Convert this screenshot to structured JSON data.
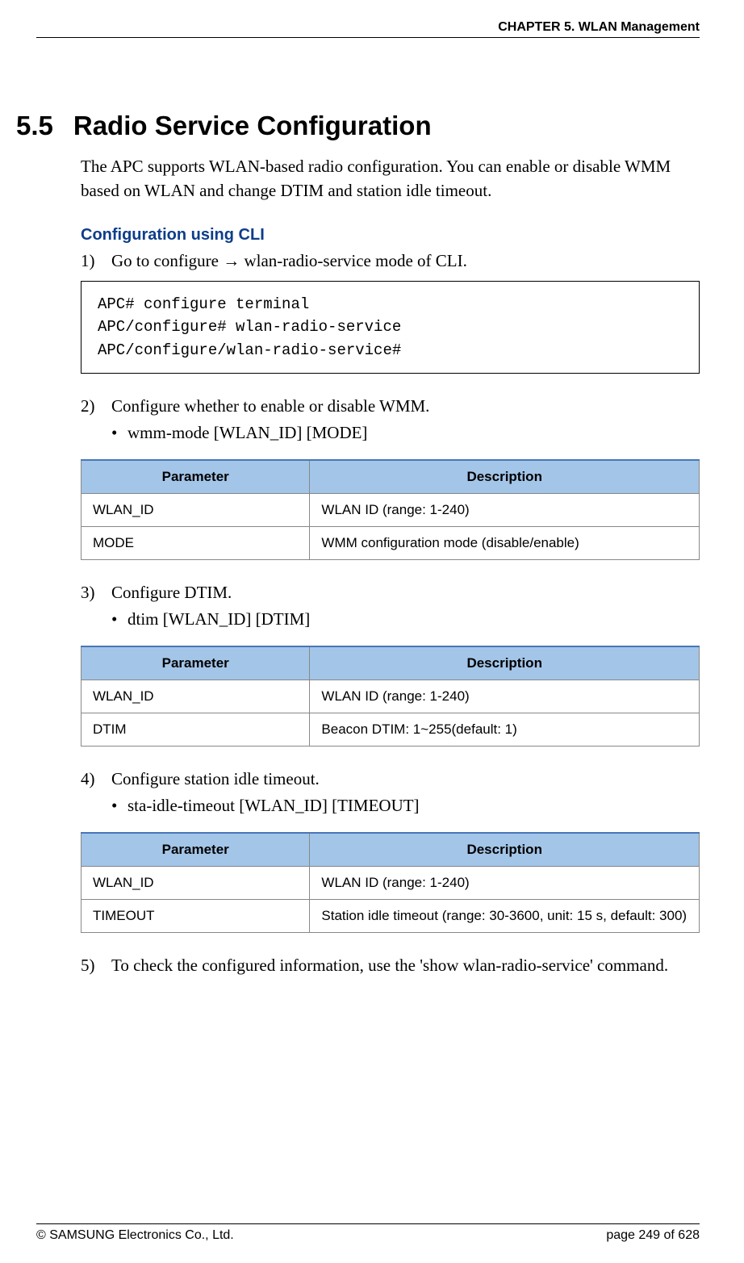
{
  "header": {
    "chapter": "CHAPTER 5. WLAN Management"
  },
  "section": {
    "number": "5.5",
    "title": "Radio Service Configuration",
    "intro": "The APC supports WLAN-based radio configuration. You can enable or disable WMM based on WLAN and change DTIM and station idle timeout."
  },
  "subsection": {
    "title": "Configuration using CLI"
  },
  "steps": {
    "s1_num": "1)",
    "s1_text": "Go to configure → wlan-radio-service mode of CLI.",
    "s2_num": "2)",
    "s2_text": "Configure whether to enable or disable WMM.",
    "s2_bullet": "wmm-mode [WLAN_ID] [MODE]",
    "s3_num": "3)",
    "s3_text": "Configure DTIM.",
    "s3_bullet": "dtim [WLAN_ID] [DTIM]",
    "s4_num": "4)",
    "s4_text": "Configure station idle timeout.",
    "s4_bullet": "sta-idle-timeout [WLAN_ID] [TIMEOUT]",
    "s5_num": "5)",
    "s5_text": "To check the configured information, use the 'show wlan-radio-service' command."
  },
  "code": "APC# configure terminal\nAPC/configure# wlan-radio-service\nAPC/configure/wlan-radio-service#",
  "table_headers": {
    "param": "Parameter",
    "desc": "Description"
  },
  "table1": {
    "r1c1": "WLAN_ID",
    "r1c2": "WLAN ID (range: 1-240)",
    "r2c1": "MODE",
    "r2c2": "WMM configuration mode (disable/enable)"
  },
  "table2": {
    "r1c1": "WLAN_ID",
    "r1c2": "WLAN ID (range: 1-240)",
    "r2c1": "DTIM",
    "r2c2": "Beacon DTIM: 1~255(default: 1)"
  },
  "table3": {
    "r1c1": "WLAN_ID",
    "r1c2": "WLAN ID (range: 1-240)",
    "r2c1": "TIMEOUT",
    "r2c2": "Station idle timeout (range: 30-3600, unit: 15 s, default: 300)"
  },
  "footer": {
    "copyright": "© SAMSUNG Electronics Co., Ltd.",
    "page": "page 249 of 628"
  }
}
